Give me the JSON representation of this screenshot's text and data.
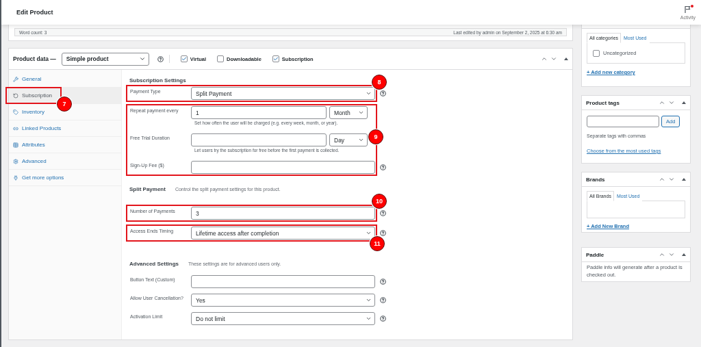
{
  "page_title": "Edit Product",
  "activity": {
    "label": "Activity",
    "unread": true
  },
  "editor_status": {
    "word_count": "Word count: 3",
    "last_edited": "Last edited by admin on September 2, 2025 at 6:30 am"
  },
  "product_data": {
    "title": "Product data —",
    "product_type": "Simple product",
    "options": [
      {
        "label": "Virtual",
        "checked": true
      },
      {
        "label": "Downloadable",
        "checked": false
      },
      {
        "label": "Subscription",
        "checked": true
      }
    ],
    "tabs": [
      {
        "label": "General",
        "selected": false
      },
      {
        "label": "Subscription",
        "selected": true,
        "callout": "7"
      },
      {
        "label": "Inventory",
        "selected": false
      },
      {
        "label": "Linked Products",
        "selected": false
      },
      {
        "label": "Attributes",
        "selected": false
      },
      {
        "label": "Advanced",
        "selected": false
      },
      {
        "label": "Get more options",
        "selected": false
      }
    ],
    "sections": [
      {
        "title": "Subscription Settings",
        "groups": [
          {
            "callout": "8",
            "fields": [
              {
                "label": "Payment Type",
                "kind": "select",
                "value": "Split Payment",
                "help": true
              }
            ]
          },
          {
            "callout": "9",
            "fields": [
              {
                "label": "Repeat payment every",
                "kind": "text_unit",
                "value": "1",
                "unit": "Month",
                "hint": "Set how often the user will be charged (e.g. every week, month, or year).",
                "help": false
              },
              {
                "label": "Free Trial Duration",
                "kind": "text_unit",
                "unit": "Day",
                "hint": "Let users try the subscription for free before the first payment is collected.",
                "help": false
              },
              {
                "label": "Sign-Up Fee ($)",
                "kind": "text",
                "help": true
              }
            ]
          }
        ]
      },
      {
        "title": "Split Payment",
        "description": "Control the split payment settings for this product.",
        "groups": [
          {
            "callout": "10",
            "fields": [
              {
                "label": "Number of Payments",
                "kind": "text",
                "value": "3",
                "help": true
              }
            ]
          },
          {
            "callout": "11",
            "fields": [
              {
                "label": "Access Ends Timing",
                "kind": "select",
                "value": "Lifetime access after completion",
                "help": true
              }
            ]
          }
        ]
      },
      {
        "title": "Advanced Settings",
        "description": "These settings are for advanced users only.",
        "groups": [
          {
            "fields": [
              {
                "label": "Button Text (Custom)",
                "kind": "text",
                "help": true
              },
              {
                "label": "Allow User Cancellation?",
                "kind": "select",
                "value": "Yes",
                "help": true
              },
              {
                "label": "Activation Limit",
                "kind": "select",
                "value": "Do not limit",
                "help": true
              }
            ]
          }
        ]
      }
    ]
  },
  "sidebar": [
    {
      "kind": "categories",
      "tabs": [
        {
          "label": "All categories",
          "selected": true
        },
        {
          "label": "Most Used",
          "selected": false
        }
      ],
      "items": [
        {
          "label": "Uncategorized",
          "checked": false
        }
      ],
      "link": "+ Add new category"
    },
    {
      "kind": "tags",
      "title": "Product tags",
      "button": "Add",
      "hint": "Separate tags with commas",
      "link": "Choose from the most used tags"
    },
    {
      "kind": "brands",
      "title": "Brands",
      "tabs": [
        {
          "label": "All Brands",
          "selected": true
        },
        {
          "label": "Most Used",
          "selected": false
        }
      ],
      "link": "+ Add New Brand"
    },
    {
      "kind": "info",
      "title": "Paddle",
      "text": "Paddle info will generate after a product is checked out."
    }
  ]
}
